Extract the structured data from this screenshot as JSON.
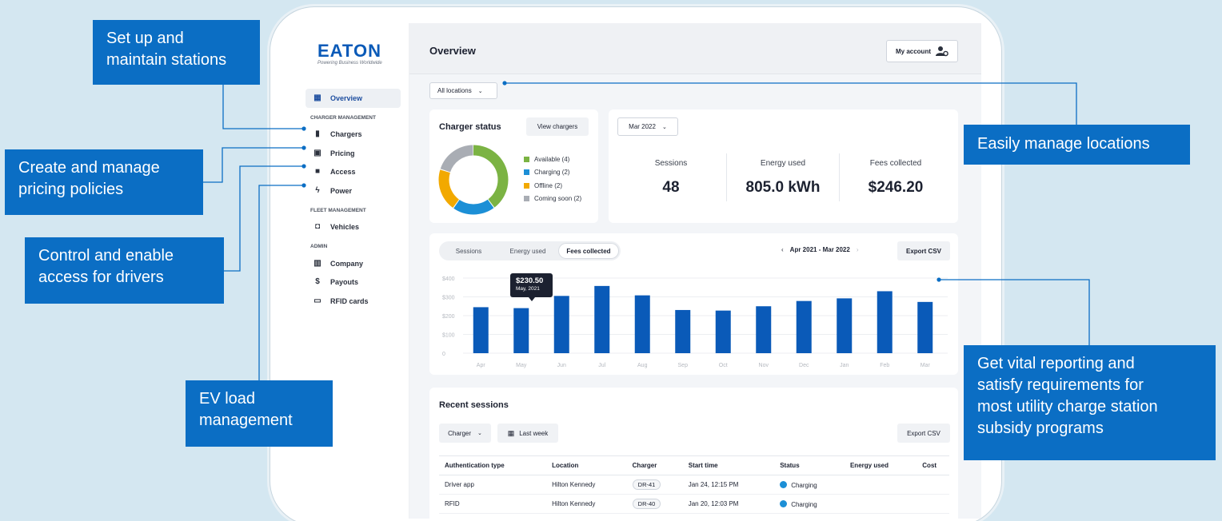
{
  "sidebar": {
    "logo": "EATON",
    "tagline": "Powering Business Worldwide",
    "overview": "Overview",
    "sections": {
      "charger_management": "CHARGER MANAGEMENT",
      "fleet_management": "FLEET MANAGEMENT",
      "admin": "ADMIN"
    },
    "items": {
      "chargers": "Chargers",
      "pricing": "Pricing",
      "access": "Access",
      "power": "Power",
      "vehicles": "Vehicles",
      "company": "Company",
      "payouts": "Payouts",
      "rfid": "RFID cards"
    }
  },
  "header": {
    "title": "Overview",
    "account": "My account"
  },
  "location_select": "All locations",
  "charger_status": {
    "title": "Charger status",
    "view_button": "View chargers",
    "legend": [
      {
        "label": "Available (4)",
        "value": 4,
        "color": "#7bb343"
      },
      {
        "label": "Charging (2)",
        "value": 2,
        "color": "#1c8fd6"
      },
      {
        "label": "Offline (2)",
        "value": 2,
        "color": "#f2a900"
      },
      {
        "label": "Coming soon (2)",
        "value": 2,
        "color": "#a9adb4"
      }
    ]
  },
  "summary": {
    "period": "Mar 2022",
    "sessions_label": "Sessions",
    "sessions_value": "48",
    "energy_label": "Energy used",
    "energy_value": "805.0 kWh",
    "fees_label": "Fees collected",
    "fees_value": "$246.20"
  },
  "report": {
    "tabs": [
      "Sessions",
      "Energy used",
      "Fees collected"
    ],
    "active_tab": "Fees collected",
    "range": "Apr 2021 - Mar 2022",
    "export": "Export CSV",
    "tooltip_value": "$230.50",
    "tooltip_date": "May, 2021"
  },
  "chart_data": {
    "type": "bar",
    "categories": [
      "Apr",
      "May",
      "Jun",
      "Jul",
      "Aug",
      "Sep",
      "Oct",
      "Nov",
      "Dec",
      "Jan",
      "Feb",
      "Mar"
    ],
    "values": [
      245,
      240,
      305,
      358,
      308,
      230,
      227,
      250,
      278,
      292,
      330,
      273
    ],
    "yticks": [
      "$400",
      "$300",
      "$200",
      "$100",
      "0"
    ],
    "ylim": [
      0,
      400
    ],
    "color": "#0a5ab8",
    "grid": true
  },
  "recent": {
    "title": "Recent sessions",
    "charger_filter": "Charger",
    "date_filter": "Last week",
    "export": "Export CSV",
    "columns": [
      "Authentication type",
      "Location",
      "Charger",
      "Start time",
      "Status",
      "Energy used",
      "Cost"
    ],
    "rows": [
      {
        "auth": "Driver app",
        "location": "Hilton Kennedy",
        "charger": "DR-41",
        "start": "Jan 24, 12:15 PM",
        "status": "Charging"
      },
      {
        "auth": "RFID",
        "location": "Hilton Kennedy",
        "charger": "DR-40",
        "start": "Jan 20, 12:03 PM",
        "status": "Charging"
      }
    ]
  },
  "callouts": {
    "stations": [
      "Set up and",
      "maintain stations"
    ],
    "pricing": [
      "Create and manage",
      "pricing policies"
    ],
    "access": [
      "Control and enable",
      "access for drivers"
    ],
    "load": [
      "EV load",
      "management"
    ],
    "locations": [
      "Easily manage locations"
    ],
    "reporting": [
      "Get vital reporting and",
      "satisfy requirements for",
      "most utility charge station",
      "subsidy programs"
    ]
  },
  "colors": {
    "callout": "#0b6ec4",
    "background": "#d4e7f1",
    "brand": "#0a5ab8"
  }
}
